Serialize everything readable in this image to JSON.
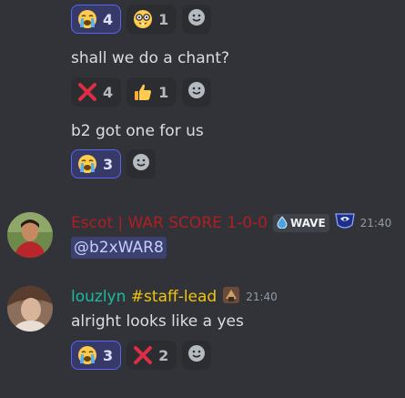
{
  "messages": [
    {
      "reactions": [
        {
          "emoji": "loudly-crying-face",
          "count": "4",
          "active": true
        },
        {
          "emoji": "nerd-face",
          "count": "1",
          "active": false
        }
      ]
    },
    {
      "text": "shall we do a chant?",
      "reactions": [
        {
          "emoji": "cross-mark",
          "count": "4",
          "active": false
        },
        {
          "emoji": "thumbs-up",
          "count": "1",
          "active": false
        }
      ]
    },
    {
      "text": "b2 got one for us",
      "reactions": [
        {
          "emoji": "loudly-crying-face",
          "count": "3",
          "active": true
        }
      ]
    },
    {
      "author": "Escot | WAR SCORE 1-0-0",
      "author_color": "#b01e22",
      "clan_tag": "WAVE",
      "timestamp": "21:40",
      "mention": "@b2xWAR8"
    },
    {
      "author": "louzlyn",
      "author_suffix": "#staff-lead",
      "author_color": "#1abc9c",
      "timestamp": "21:40",
      "text": "alright looks like a yes",
      "reactions": [
        {
          "emoji": "loudly-crying-face",
          "count": "3",
          "active": true
        },
        {
          "emoji": "cross-mark",
          "count": "2",
          "active": false
        }
      ]
    }
  ],
  "colors": {
    "background": "#313338",
    "reaction_bg": "#2b2d31",
    "reaction_active_bg": "#373a68",
    "reaction_active_border": "#5865f2",
    "mention_bg": "#3c4270"
  }
}
